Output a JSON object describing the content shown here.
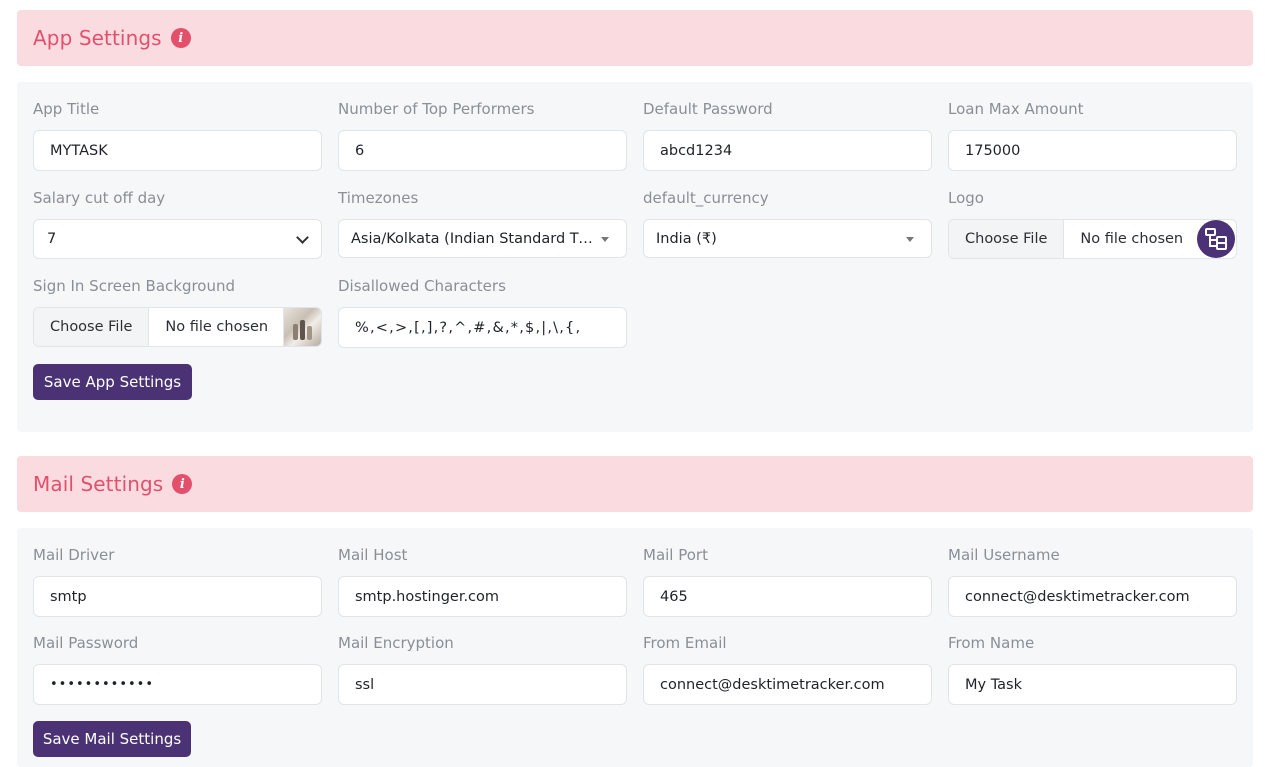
{
  "app_settings": {
    "title": "App Settings",
    "info_icon": "info-icon",
    "fields": {
      "app_title": {
        "label": "App Title",
        "value": "MYTASK"
      },
      "top_performers": {
        "label": "Number of Top Performers",
        "value": "6"
      },
      "default_password": {
        "label": "Default Password",
        "value": "abcd1234"
      },
      "loan_max_amount": {
        "label": "Loan Max Amount",
        "value": "175000"
      },
      "salary_cut_off_day": {
        "label": "Salary cut off day",
        "value": "7"
      },
      "timezones": {
        "label": "Timezones",
        "value": "Asia/Kolkata (Indian Standard Time)"
      },
      "default_currency": {
        "label": "default_currency",
        "value": "India (₹)"
      },
      "logo": {
        "label": "Logo",
        "button": "Choose File",
        "status": "No file chosen"
      },
      "sign_in_background": {
        "label": "Sign In Screen Background",
        "button": "Choose File",
        "status": "No file chosen"
      },
      "disallowed_characters": {
        "label": "Disallowed Characters",
        "value": "%,<,>,[,],?,^,#,&,*,$,|,\\,{,"
      }
    },
    "save_label": "Save App Settings"
  },
  "mail_settings": {
    "title": "Mail Settings",
    "info_icon": "info-icon",
    "fields": {
      "mail_driver": {
        "label": "Mail Driver",
        "value": "smtp"
      },
      "mail_host": {
        "label": "Mail Host",
        "value": "smtp.hostinger.com"
      },
      "mail_port": {
        "label": "Mail Port",
        "value": "465"
      },
      "mail_username": {
        "label": "Mail Username",
        "value": "connect@desktimetracker.com"
      },
      "mail_password": {
        "label": "Mail Password",
        "value": "••••••••••••"
      },
      "mail_encryption": {
        "label": "Mail Encryption",
        "value": "ssl"
      },
      "from_email": {
        "label": "From Email",
        "value": "connect@desktimetracker.com"
      },
      "from_name": {
        "label": "From Name",
        "value": "My Task"
      }
    },
    "save_label": "Save Mail Settings"
  },
  "colors": {
    "header_bg": "#fadbe0",
    "header_text": "#e3506c",
    "card_bg": "#f6f7f9",
    "primary_button": "#4a3275"
  }
}
